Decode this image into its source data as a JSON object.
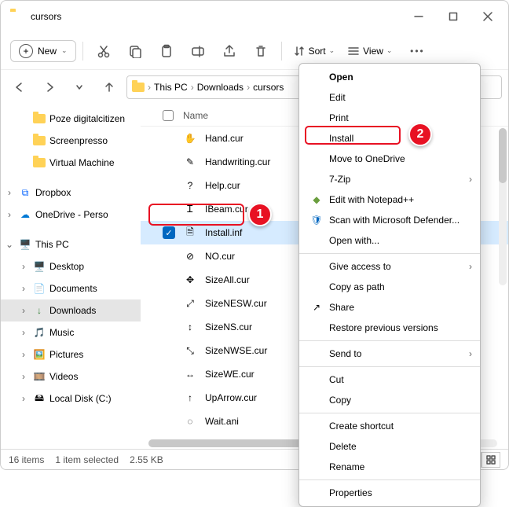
{
  "titlebar": {
    "title": "cursors"
  },
  "toolbar": {
    "new_label": "New",
    "sort_label": "Sort",
    "view_label": "View"
  },
  "breadcrumb": [
    "This PC",
    "Downloads",
    "cursors"
  ],
  "sidebar": {
    "quick": [
      {
        "label": "Poze digitalcitizen"
      },
      {
        "label": "Screenpresso"
      },
      {
        "label": "Virtual Machine"
      }
    ],
    "cloud": [
      {
        "label": "Dropbox",
        "chev": "›"
      },
      {
        "label": "OneDrive - Perso",
        "chev": "›"
      }
    ],
    "thispc_label": "This PC",
    "thispc_chev": "⌄",
    "thispc_items": [
      {
        "label": "Desktop"
      },
      {
        "label": "Documents"
      },
      {
        "label": "Downloads",
        "selected": true,
        "dl": true
      },
      {
        "label": "Music"
      },
      {
        "label": "Pictures"
      },
      {
        "label": "Videos"
      },
      {
        "label": "Local Disk (C:)"
      }
    ]
  },
  "columns": {
    "name_label": "Name"
  },
  "files": [
    {
      "name": "Hand.cur",
      "ic": "✋"
    },
    {
      "name": "Handwriting.cur",
      "ic": "✎"
    },
    {
      "name": "Help.cur",
      "ic": "?"
    },
    {
      "name": "IBeam.cur",
      "ic": "Ꮖ"
    },
    {
      "name": "Install.inf",
      "ic": "🗎",
      "selected": true
    },
    {
      "name": "NO.cur",
      "ic": "⊘"
    },
    {
      "name": "SizeAll.cur",
      "ic": "✥"
    },
    {
      "name": "SizeNESW.cur",
      "ic": "⤢"
    },
    {
      "name": "SizeNS.cur",
      "ic": "↕"
    },
    {
      "name": "SizeNWSE.cur",
      "ic": "⤡"
    },
    {
      "name": "SizeWE.cur",
      "ic": "↔"
    },
    {
      "name": "UpArrow.cur",
      "ic": "↑"
    },
    {
      "name": "Wait.ani",
      "ic": "◌"
    }
  ],
  "context_menu": {
    "items1": [
      {
        "label": "Open",
        "bold": true
      },
      {
        "label": "Edit"
      },
      {
        "label": "Print"
      },
      {
        "label": "Install"
      },
      {
        "label": "Move to OneDrive"
      },
      {
        "label": "7-Zip",
        "sub": true
      },
      {
        "label": "Edit with Notepad++",
        "icon": "np"
      },
      {
        "label": "Scan with Microsoft Defender...",
        "icon": "shield"
      },
      {
        "label": "Open with..."
      }
    ],
    "items2": [
      {
        "label": "Give access to",
        "sub": true
      },
      {
        "label": "Copy as path"
      },
      {
        "label": "Share",
        "icon": "share"
      },
      {
        "label": "Restore previous versions"
      }
    ],
    "items3": [
      {
        "label": "Send to",
        "sub": true
      }
    ],
    "items4": [
      {
        "label": "Cut"
      },
      {
        "label": "Copy"
      }
    ],
    "items5": [
      {
        "label": "Create shortcut"
      },
      {
        "label": "Delete"
      },
      {
        "label": "Rename"
      }
    ],
    "items6": [
      {
        "label": "Properties"
      }
    ]
  },
  "statusbar": {
    "count": "16 items",
    "selected": "1 item selected",
    "size": "2.55 KB"
  },
  "annotations": {
    "badge1": "1",
    "badge2": "2"
  }
}
